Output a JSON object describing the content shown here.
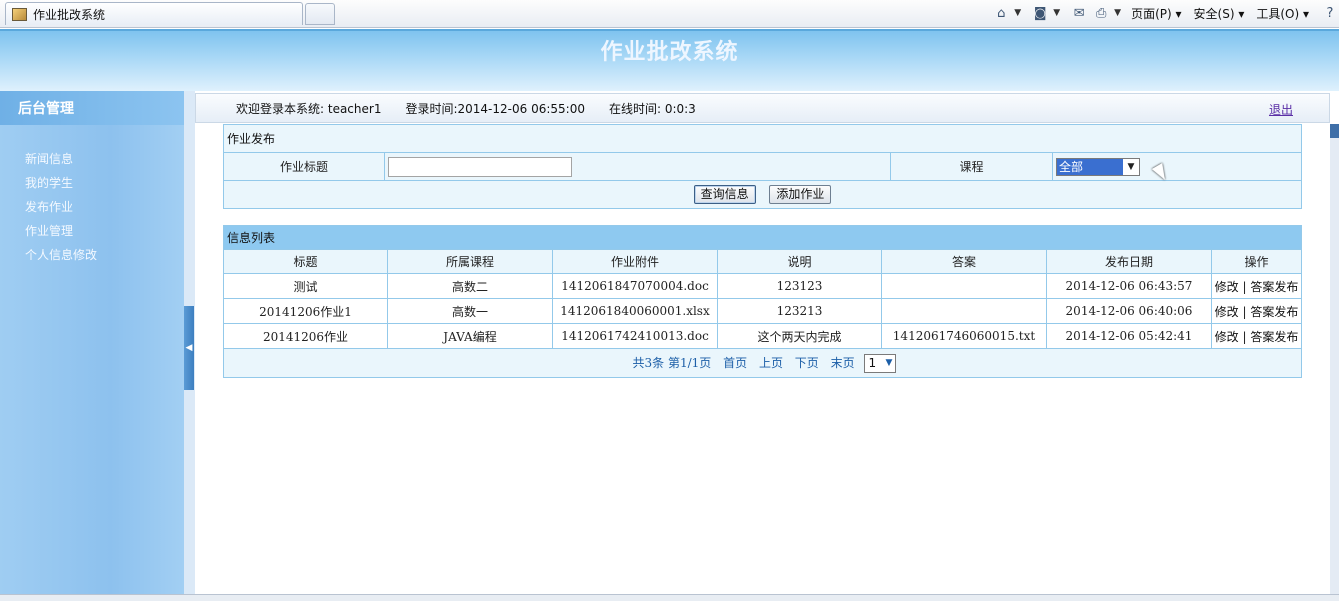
{
  "browser": {
    "tab_title": "作业批改系统",
    "menus": [
      "页面(P)",
      "安全(S)",
      "工具(O)"
    ]
  },
  "header": {
    "site_title": "作业批改系统"
  },
  "sidebar": {
    "title": "后台管理",
    "items": [
      {
        "label": "新闻信息"
      },
      {
        "label": "我的学生"
      },
      {
        "label": "发布作业"
      },
      {
        "label": "作业管理"
      },
      {
        "label": "个人信息修改"
      }
    ]
  },
  "infobar": {
    "welcome": "欢迎登录本系统: teacher1",
    "login_time": "登录时间:2014-12-06 06:55:00",
    "online_time": "在线时间: 0:0:3",
    "logout": "退出"
  },
  "publish_form": {
    "caption": "作业发布",
    "title_label": "作业标题",
    "title_value": "",
    "course_label": "课程",
    "course_selected": "全部",
    "query_button": "查询信息",
    "add_button": "添加作业"
  },
  "info_list": {
    "caption": "信息列表",
    "columns": [
      "标题",
      "所属课程",
      "作业附件",
      "说明",
      "答案",
      "发布日期",
      "操作"
    ],
    "rows": [
      {
        "title": "测试",
        "course": "高数二",
        "attachment": "1412061847070004.doc",
        "desc": "123123",
        "answer": "",
        "date": "2014-12-06 06:43:57",
        "edit": "修改",
        "publish": "答案发布"
      },
      {
        "title": "20141206作业1",
        "course": "高数一",
        "attachment": "1412061840060001.xlsx",
        "desc": "123213",
        "answer": "",
        "date": "2014-12-06 06:40:06",
        "edit": "修改",
        "publish": "答案发布"
      },
      {
        "title": "20141206作业",
        "course": "JAVA编程",
        "attachment": "1412061742410013.doc",
        "desc": "这个两天内完成",
        "answer": "1412061746060015.txt",
        "date": "2014-12-06 05:42:41",
        "edit": "修改",
        "publish": "答案发布"
      }
    ],
    "pager": {
      "summary": "共3条 第1/1页",
      "first": "首页",
      "prev": "上页",
      "next": "下页",
      "last": "末页",
      "page_value": "1"
    }
  }
}
